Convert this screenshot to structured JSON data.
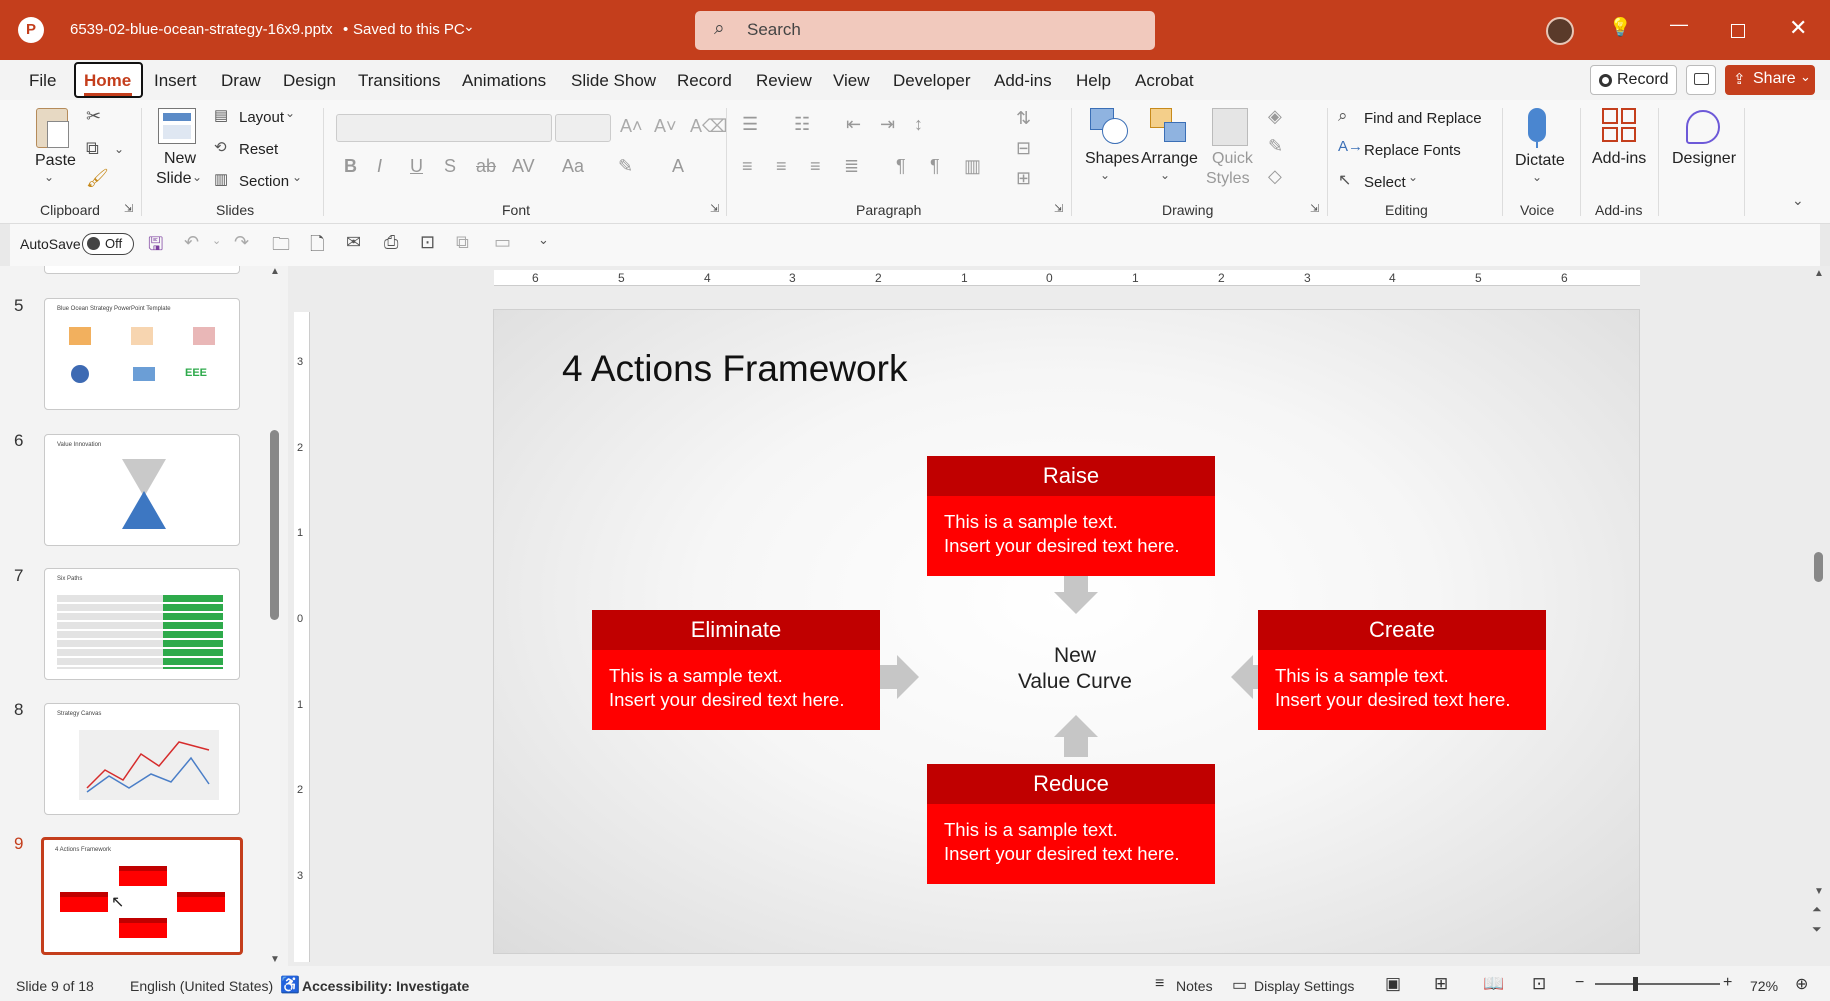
{
  "titlebar": {
    "filename": "6539-02-blue-ocean-strategy-16x9.pptx",
    "save_status": "Saved to this PC",
    "search_placeholder": "Search"
  },
  "menu": [
    "File",
    "Home",
    "Insert",
    "Draw",
    "Design",
    "Transitions",
    "Animations",
    "Slide Show",
    "Record",
    "Review",
    "View",
    "Developer",
    "Add-ins",
    "Help",
    "Acrobat"
  ],
  "menu_right": {
    "record": "Record",
    "share": "Share"
  },
  "ribbon": {
    "paste": "Paste",
    "new_slide": "New",
    "new_slide2": "Slide",
    "layout": "Layout",
    "reset": "Reset",
    "section": "Section",
    "shapes": "Shapes",
    "arrange": "Arrange",
    "quick_styles": "Quick",
    "quick_styles2": "Styles",
    "find_replace": "Find and Replace",
    "replace_fonts": "Replace Fonts",
    "select": "Select",
    "dictate": "Dictate",
    "addins": "Add-ins",
    "designer": "Designer",
    "groups": {
      "clipboard": "Clipboard",
      "slides": "Slides",
      "font": "Font",
      "paragraph": "Paragraph",
      "drawing": "Drawing",
      "editing": "Editing",
      "voice": "Voice",
      "addins": "Add-ins"
    }
  },
  "qat": {
    "autosave": "AutoSave",
    "toggle": "Off"
  },
  "ruler": {
    "labels": [
      "6",
      "5",
      "4",
      "3",
      "2",
      "1",
      "0",
      "1",
      "2",
      "3",
      "4",
      "5",
      "6"
    ],
    "vlabels": [
      "3",
      "2",
      "1",
      "0",
      "1",
      "2",
      "3"
    ]
  },
  "thumbnails": [
    {
      "num": "5",
      "title": "Blue Ocean Strategy PowerPoint Template"
    },
    {
      "num": "6",
      "title": "Value Innovation"
    },
    {
      "num": "7",
      "title": "Six Paths"
    },
    {
      "num": "8",
      "title": "Strategy Canvas"
    },
    {
      "num": "9",
      "title": "4 Actions Framework"
    }
  ],
  "slide": {
    "title": "4 Actions Framework",
    "center_line1": "New",
    "center_line2": "Value Curve",
    "boxes": {
      "raise": {
        "title": "Raise",
        "line1": "This is a sample text.",
        "line2": "Insert your desired text here."
      },
      "eliminate": {
        "title": "Eliminate",
        "line1": "This is a sample text.",
        "line2": "Insert your desired text here."
      },
      "create": {
        "title": "Create",
        "line1": "This is a sample text.",
        "line2": "Insert your desired text here."
      },
      "reduce": {
        "title": "Reduce",
        "line1": "This is a sample text.",
        "line2": "Insert your desired text here."
      }
    }
  },
  "status": {
    "slide": "Slide 9 of 18",
    "language": "English (United States)",
    "accessibility": "Accessibility: Investigate",
    "notes": "Notes",
    "display": "Display Settings",
    "zoom": "72%"
  },
  "colors": {
    "brand": "#c43e1c",
    "box_header": "#c00000",
    "box_body": "#ff0000",
    "arrow": "#c6c6c6"
  }
}
